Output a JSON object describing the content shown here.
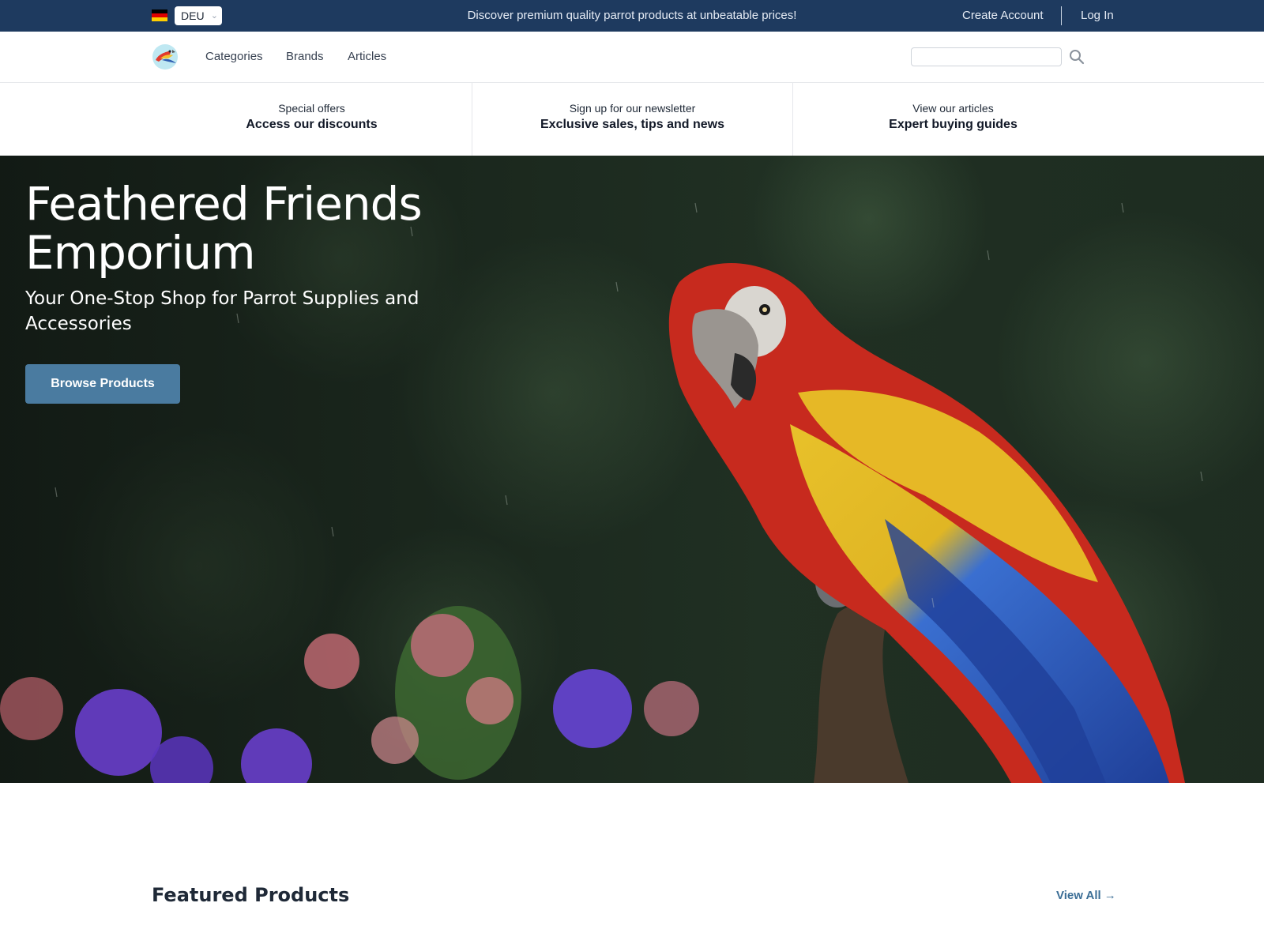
{
  "topbar": {
    "country_code": "DEU",
    "flag_colors": [
      "#000000",
      "#dd0000",
      "#ffce00"
    ],
    "announcement": "Discover premium quality parrot products at unbeatable prices!",
    "create_account": "Create Account",
    "log_in": "Log In",
    "background_color": "#1e3a5f"
  },
  "nav": {
    "logo_icon": "parrot-logo-icon",
    "links": [
      "Categories",
      "Brands",
      "Articles"
    ],
    "search": {
      "value": "",
      "placeholder": ""
    },
    "search_icon": "magnifier-icon"
  },
  "promo": [
    {
      "small": "Special offers",
      "big": "Access our discounts"
    },
    {
      "small": "Sign up for our newsletter",
      "big": "Exclusive sales, tips and news"
    },
    {
      "small": "View our articles",
      "big": "Expert buying guides"
    }
  ],
  "hero": {
    "title": "Feathered Friends Emporium",
    "subtitle": "Your One-Stop Shop for Parrot Supplies and Accessories",
    "cta": "Browse Products",
    "cta_color": "#4a7ba0"
  },
  "featured": {
    "title": "Featured Products",
    "view_all": "View All",
    "view_all_color": "#3b6e96"
  }
}
